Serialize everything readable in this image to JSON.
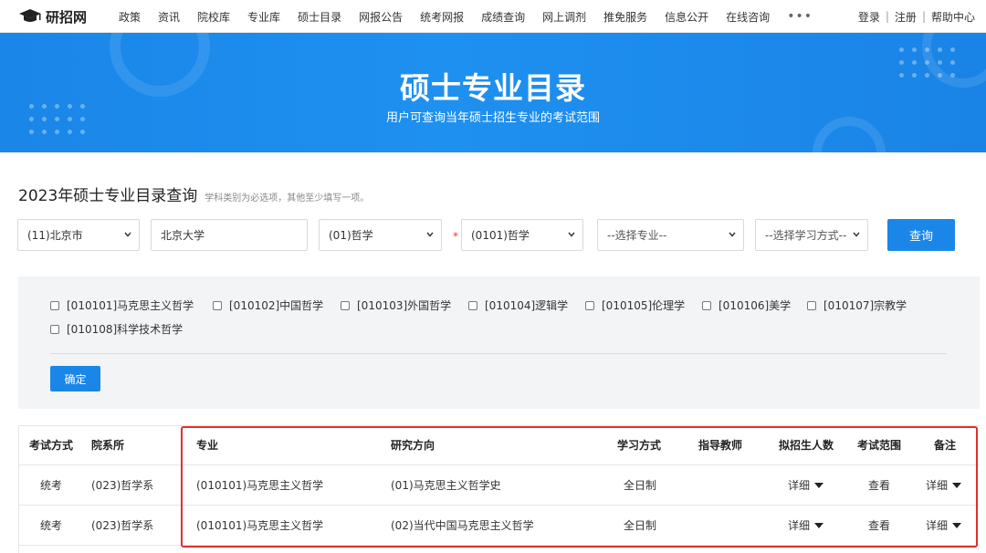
{
  "nav": {
    "logo_text": "研招网",
    "links": [
      "政策",
      "资讯",
      "院校库",
      "专业库",
      "硕士目录",
      "网报公告",
      "统考网报",
      "成绩查询",
      "网上调剂",
      "推免服务",
      "信息公开",
      "在线咨询"
    ],
    "more": "•••",
    "login": "登录",
    "sep": "|",
    "register": "注册",
    "help": "帮助中心"
  },
  "banner": {
    "title": "硕士专业目录",
    "subtitle": "用户可查询当年硕士招生专业的考试范围"
  },
  "query": {
    "title": "2023年硕士专业目录查询",
    "hint": "学科类别为必选项，其他至少填写一项。",
    "province": "(11)北京市",
    "school": "北京大学",
    "category": "(01)哲学",
    "required_mark": "*",
    "discipline": "(0101)哲学",
    "major": "--选择专业--",
    "study_mode": "--选择学习方式--",
    "submit": "查询"
  },
  "majors": {
    "options": [
      "[010101]马克思主义哲学",
      "[010102]中国哲学",
      "[010103]外国哲学",
      "[010104]逻辑学",
      "[010105]伦理学",
      "[010106]美学",
      "[010107]宗教学",
      "[010108]科学技术哲学"
    ],
    "confirm": "确定"
  },
  "table": {
    "headers": [
      "考试方式",
      "院系所",
      "专业",
      "研究方向",
      "学习方式",
      "指导教师",
      "拟招生人数",
      "考试范围",
      "备注"
    ],
    "rows": [
      {
        "exam": "统考",
        "dept": "(023)哲学系",
        "major": "(010101)马克思主义哲学",
        "direction": "(01)马克思主义哲学史",
        "mode": "全日制",
        "advisor": "",
        "quota": "详细",
        "scope": "查看",
        "note": "详细"
      },
      {
        "exam": "统考",
        "dept": "(023)哲学系",
        "major": "(010101)马克思主义哲学",
        "direction": "(02)当代中国马克思主义哲学",
        "mode": "全日制",
        "advisor": "",
        "quota": "详细",
        "scope": "查看",
        "note": "详细"
      }
    ]
  },
  "colors": {
    "primary": "#1a86e8",
    "highlight_border": "#e0302a",
    "panel_bg": "#f3f4f6"
  },
  "icons": [
    "graduation-cap-icon",
    "chevron-down-icon",
    "caret-down-icon",
    "checkbox-icon"
  ]
}
